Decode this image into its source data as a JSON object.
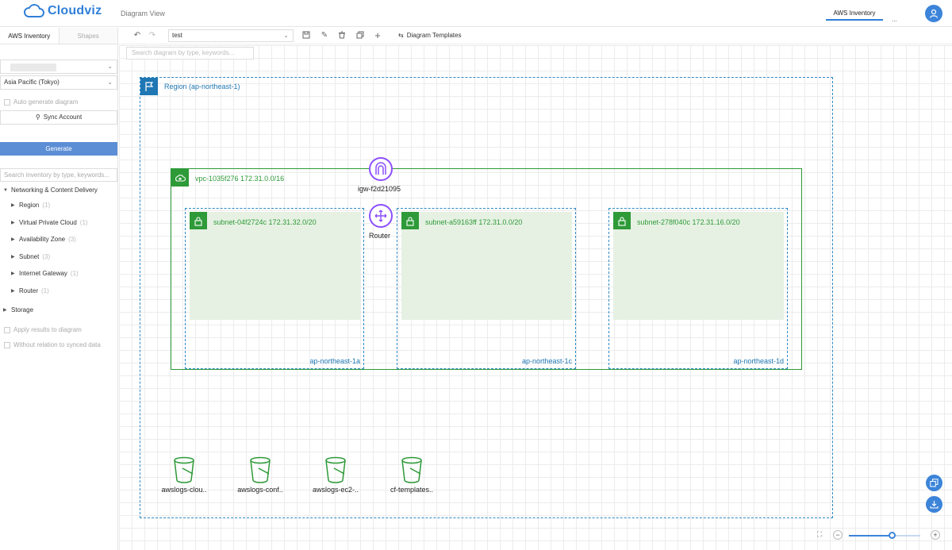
{
  "header": {
    "app_name": "Cloudviz",
    "page_title": "Diagram View",
    "active_tab": "AWS Inventory",
    "more_label": "...",
    "brand_color": "#2f7fd8"
  },
  "sidebar": {
    "tabs": [
      "AWS Inventory",
      "Shapes"
    ],
    "account_select": "",
    "region_select": "Asia Pacific (Tokyo)",
    "auto_generate_label": "Auto generate diagram",
    "sync_label": "Sync Account",
    "generate_label": "Generate",
    "search_placeholder": "Search inventory by type, keywords...",
    "tree": [
      {
        "label": "Networking & Content Delivery",
        "count": ""
      },
      {
        "label": "Region",
        "count": "(1)"
      },
      {
        "label": "Virtual Private Cloud",
        "count": "(1)"
      },
      {
        "label": "Availability Zone",
        "count": "(3)"
      },
      {
        "label": "Subnet",
        "count": "(3)"
      },
      {
        "label": "Internet Gateway",
        "count": "(1)"
      },
      {
        "label": "Router",
        "count": "(1)"
      },
      {
        "label": "Storage",
        "count": ""
      }
    ],
    "apply_results_label": "Apply results to diagram",
    "without_relation_label": "Without relation to synced data"
  },
  "toolbar": {
    "diagram_name": "test",
    "templates_label": "Diagram Templates",
    "search_placeholder": "Search diagram by type, keywords..."
  },
  "diagram": {
    "region_label": "Region (ap-northeast-1)",
    "vpc_label": "vpc-1035f276 172.31.0.0/16",
    "igw_label": "igw-f2d21095",
    "router_label": "Router",
    "azs": [
      {
        "subnet": "subnet-04f2724c 172.31.32.0/20",
        "az": "ap-northeast-1a"
      },
      {
        "subnet": "subnet-a59163ff 172.31.0.0/20",
        "az": "ap-northeast-1c"
      },
      {
        "subnet": "subnet-278f040c 172.31.16.0/20",
        "az": "ap-northeast-1d"
      }
    ],
    "buckets": [
      "awslogs-clou..",
      "awslogs-conf..",
      "awslogs-ec2-..",
      "cf-templates.."
    ],
    "colors": {
      "region": "#1f77b4",
      "vpc": "#2e9a38",
      "network_node": "#8c4fff",
      "bucket": "#2e9a38"
    }
  },
  "zoom": {
    "level_fraction": 0.6
  }
}
